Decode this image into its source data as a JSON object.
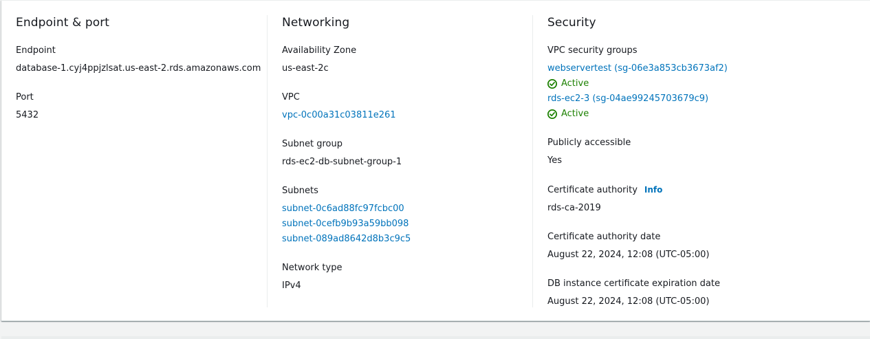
{
  "endpoint_port": {
    "title": "Endpoint & port",
    "endpoint_label": "Endpoint",
    "endpoint_value": "database-1.cyj4ppjzlsat.us-east-2.rds.amazonaws.com",
    "port_label": "Port",
    "port_value": "5432"
  },
  "networking": {
    "title": "Networking",
    "az_label": "Availability Zone",
    "az_value": "us-east-2c",
    "vpc_label": "VPC",
    "vpc_value": "vpc-0c00a31c03811e261",
    "subnet_group_label": "Subnet group",
    "subnet_group_value": "rds-ec2-db-subnet-group-1",
    "subnets_label": "Subnets",
    "subnets": [
      "subnet-0c6ad88fc97fcbc00",
      "subnet-0cefb9b93a59bb098",
      "subnet-089ad8642d8b3c9c5"
    ],
    "network_type_label": "Network type",
    "network_type_value": "IPv4"
  },
  "security": {
    "title": "Security",
    "vpc_sg_label": "VPC security groups",
    "security_groups": [
      {
        "name": "webservertest (sg-06e3a853cb3673af2)",
        "status": "Active"
      },
      {
        "name": "rds-ec2-3 (sg-04ae99245703679c9)",
        "status": "Active"
      }
    ],
    "public_label": "Publicly accessible",
    "public_value": "Yes",
    "ca_label": "Certificate authority",
    "ca_info": "Info",
    "ca_value": "rds-ca-2019",
    "ca_date_label": "Certificate authority date",
    "ca_date_value": "August 22, 2024, 12:08 (UTC-05:00)",
    "cert_exp_label": "DB instance certificate expiration date",
    "cert_exp_value": "August 22, 2024, 12:08 (UTC-05:00)"
  },
  "colors": {
    "link": "#0073bb",
    "success": "#1d8102",
    "text": "#16191f"
  },
  "icons": {
    "status": "check-circle-icon"
  }
}
